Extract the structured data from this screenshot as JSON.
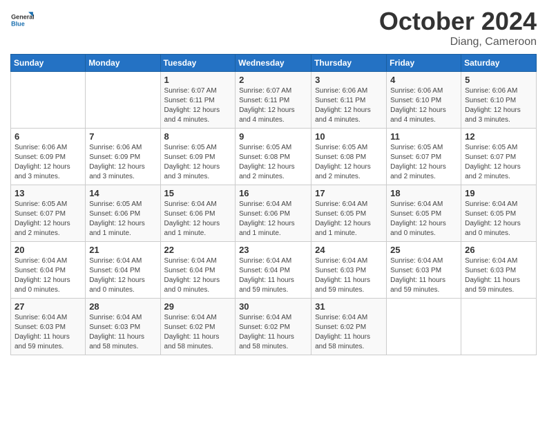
{
  "logo": {
    "line1": "General",
    "line2": "Blue"
  },
  "title": "October 2024",
  "location": "Diang, Cameroon",
  "weekdays": [
    "Sunday",
    "Monday",
    "Tuesday",
    "Wednesday",
    "Thursday",
    "Friday",
    "Saturday"
  ],
  "weeks": [
    [
      {
        "day": "",
        "info": ""
      },
      {
        "day": "",
        "info": ""
      },
      {
        "day": "1",
        "info": "Sunrise: 6:07 AM\nSunset: 6:11 PM\nDaylight: 12 hours\nand 4 minutes."
      },
      {
        "day": "2",
        "info": "Sunrise: 6:07 AM\nSunset: 6:11 PM\nDaylight: 12 hours\nand 4 minutes."
      },
      {
        "day": "3",
        "info": "Sunrise: 6:06 AM\nSunset: 6:11 PM\nDaylight: 12 hours\nand 4 minutes."
      },
      {
        "day": "4",
        "info": "Sunrise: 6:06 AM\nSunset: 6:10 PM\nDaylight: 12 hours\nand 4 minutes."
      },
      {
        "day": "5",
        "info": "Sunrise: 6:06 AM\nSunset: 6:10 PM\nDaylight: 12 hours\nand 3 minutes."
      }
    ],
    [
      {
        "day": "6",
        "info": "Sunrise: 6:06 AM\nSunset: 6:09 PM\nDaylight: 12 hours\nand 3 minutes."
      },
      {
        "day": "7",
        "info": "Sunrise: 6:06 AM\nSunset: 6:09 PM\nDaylight: 12 hours\nand 3 minutes."
      },
      {
        "day": "8",
        "info": "Sunrise: 6:05 AM\nSunset: 6:09 PM\nDaylight: 12 hours\nand 3 minutes."
      },
      {
        "day": "9",
        "info": "Sunrise: 6:05 AM\nSunset: 6:08 PM\nDaylight: 12 hours\nand 2 minutes."
      },
      {
        "day": "10",
        "info": "Sunrise: 6:05 AM\nSunset: 6:08 PM\nDaylight: 12 hours\nand 2 minutes."
      },
      {
        "day": "11",
        "info": "Sunrise: 6:05 AM\nSunset: 6:07 PM\nDaylight: 12 hours\nand 2 minutes."
      },
      {
        "day": "12",
        "info": "Sunrise: 6:05 AM\nSunset: 6:07 PM\nDaylight: 12 hours\nand 2 minutes."
      }
    ],
    [
      {
        "day": "13",
        "info": "Sunrise: 6:05 AM\nSunset: 6:07 PM\nDaylight: 12 hours\nand 2 minutes."
      },
      {
        "day": "14",
        "info": "Sunrise: 6:05 AM\nSunset: 6:06 PM\nDaylight: 12 hours\nand 1 minute."
      },
      {
        "day": "15",
        "info": "Sunrise: 6:04 AM\nSunset: 6:06 PM\nDaylight: 12 hours\nand 1 minute."
      },
      {
        "day": "16",
        "info": "Sunrise: 6:04 AM\nSunset: 6:06 PM\nDaylight: 12 hours\nand 1 minute."
      },
      {
        "day": "17",
        "info": "Sunrise: 6:04 AM\nSunset: 6:05 PM\nDaylight: 12 hours\nand 1 minute."
      },
      {
        "day": "18",
        "info": "Sunrise: 6:04 AM\nSunset: 6:05 PM\nDaylight: 12 hours\nand 0 minutes."
      },
      {
        "day": "19",
        "info": "Sunrise: 6:04 AM\nSunset: 6:05 PM\nDaylight: 12 hours\nand 0 minutes."
      }
    ],
    [
      {
        "day": "20",
        "info": "Sunrise: 6:04 AM\nSunset: 6:04 PM\nDaylight: 12 hours\nand 0 minutes."
      },
      {
        "day": "21",
        "info": "Sunrise: 6:04 AM\nSunset: 6:04 PM\nDaylight: 12 hours\nand 0 minutes."
      },
      {
        "day": "22",
        "info": "Sunrise: 6:04 AM\nSunset: 6:04 PM\nDaylight: 12 hours\nand 0 minutes."
      },
      {
        "day": "23",
        "info": "Sunrise: 6:04 AM\nSunset: 6:04 PM\nDaylight: 11 hours\nand 59 minutes."
      },
      {
        "day": "24",
        "info": "Sunrise: 6:04 AM\nSunset: 6:03 PM\nDaylight: 11 hours\nand 59 minutes."
      },
      {
        "day": "25",
        "info": "Sunrise: 6:04 AM\nSunset: 6:03 PM\nDaylight: 11 hours\nand 59 minutes."
      },
      {
        "day": "26",
        "info": "Sunrise: 6:04 AM\nSunset: 6:03 PM\nDaylight: 11 hours\nand 59 minutes."
      }
    ],
    [
      {
        "day": "27",
        "info": "Sunrise: 6:04 AM\nSunset: 6:03 PM\nDaylight: 11 hours\nand 59 minutes."
      },
      {
        "day": "28",
        "info": "Sunrise: 6:04 AM\nSunset: 6:03 PM\nDaylight: 11 hours\nand 58 minutes."
      },
      {
        "day": "29",
        "info": "Sunrise: 6:04 AM\nSunset: 6:02 PM\nDaylight: 11 hours\nand 58 minutes."
      },
      {
        "day": "30",
        "info": "Sunrise: 6:04 AM\nSunset: 6:02 PM\nDaylight: 11 hours\nand 58 minutes."
      },
      {
        "day": "31",
        "info": "Sunrise: 6:04 AM\nSunset: 6:02 PM\nDaylight: 11 hours\nand 58 minutes."
      },
      {
        "day": "",
        "info": ""
      },
      {
        "day": "",
        "info": ""
      }
    ]
  ]
}
